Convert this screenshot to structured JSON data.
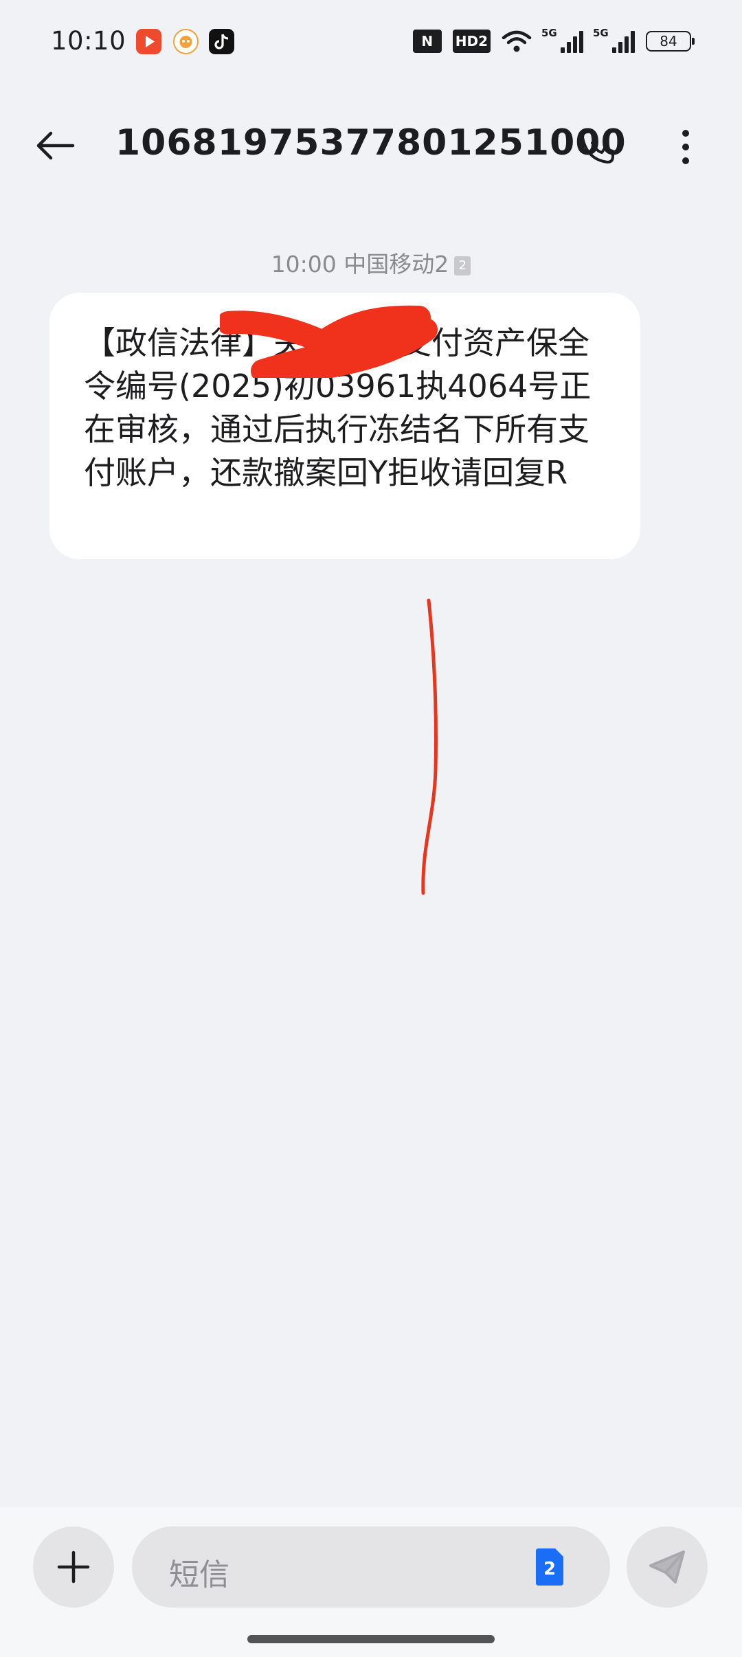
{
  "status_bar": {
    "time": "10:10",
    "nfc_label": "N",
    "hd_label": "HD2",
    "sim1_network": "5G",
    "sim2_network": "5G",
    "battery_level": "84",
    "app_icons": [
      "video-app-icon",
      "orange-app-icon",
      "tiktok-icon"
    ]
  },
  "header": {
    "title": "10681975377801251000",
    "icons": [
      "back-arrow-icon",
      "phone-icon",
      "more-vertical-icon"
    ]
  },
  "conversation": {
    "timestamp": "10:00",
    "carrier": "中国移动2",
    "sim_badge": "2",
    "message": {
      "text": "【政信法律】关于你的支付资产保全令编号(2025)初03961执4064号正在审核，通过后执行冻结名下所有支付账户，还款撤案回Y拒收请回复R",
      "redaction_color": "#f0311c"
    }
  },
  "annotation": {
    "color": "#e8361e"
  },
  "compose": {
    "placeholder": "短信",
    "sim_indicator": "2",
    "sim_indicator_color": "#1a6ef5",
    "icons": [
      "plus-icon",
      "sim-card-icon",
      "send-icon"
    ]
  }
}
